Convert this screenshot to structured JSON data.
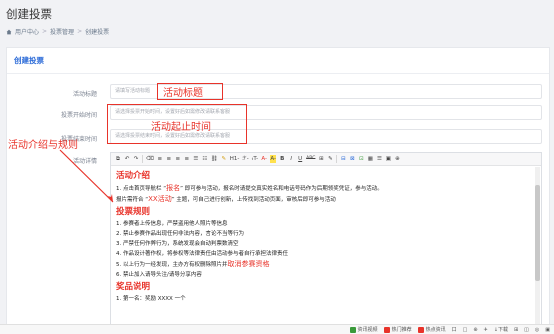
{
  "page": {
    "title": "创建投票"
  },
  "breadcrumb": {
    "items": [
      "用户中心",
      "投票管理",
      "创建投票"
    ],
    "sep": ">"
  },
  "card": {
    "header": "创建投票"
  },
  "form": {
    "activity_title_label": "活动标题",
    "activity_title_placeholder": "请填写活动标题",
    "start_time_label": "投票开始时间",
    "start_time_placeholder": "请选择投票开始时间，设置好后如需修改请联系客服",
    "end_time_label": "投票结束时间",
    "end_time_placeholder": "请选择投票结束时间，设置好后如需修改请联系客服",
    "details_label": "活动详情"
  },
  "annotations": {
    "title_note": "活动标题",
    "time_note": "活动起止时间",
    "intro_note": "活动介绍与规则",
    "accent_color": "#e8332a"
  },
  "toolbar": {
    "buttons": [
      "源码",
      "撤销",
      "重做",
      "清除",
      "左对齐",
      "居中",
      "右对齐",
      "两端",
      "有序",
      "无序",
      "链接",
      "格式刷",
      "H1-",
      "ℱ-",
      "ₜT-",
      "A-",
      "A-",
      "B",
      "I",
      "U",
      "ABC",
      "⊞",
      "✎",
      "⊟",
      "⊠",
      "⊡",
      "▦",
      "☰",
      "▣",
      "⊕"
    ]
  },
  "editor": {
    "sec1": "活动介绍",
    "line1_a": "1. 点击首页导航栏 “",
    "line1_hl": "报名",
    "line1_b": "” 即可参与活动，报名时请提交真实姓名和电话号码作为后期领奖凭证，参与活动。",
    "line2_a": "报片需符合 “",
    "line2_hl": "XX活动",
    "line2_b": "” 主题，可自己进行创新，上传找到活动页面，审核后即可参与活动",
    "sec2": "投票规则",
    "rules": [
      "1. 参赛者上传信息，严禁盗用他人照片等信息",
      "2. 禁止参赛作品出现任何非法内容，言论不当等行为",
      "3. 严禁任何作弊行为，系统发现会自动判票数清空",
      "4. 作品设计著作权，将参权等法律责任由活动参与者自行承担法律责任"
    ],
    "rule5_a": "5. 以上行为一经发现，主办方有权删除照片并",
    "rule5_hl": "取消参赛资格",
    "rule6": "6. 禁止加入请导头注/请导分享内容",
    "sec3": "奖品说明",
    "prize1": "1. 第一名：奖励 XXXX 一个"
  },
  "taskbar": {
    "items": [
      "资讯视频",
      "热门推荐",
      "热点资讯",
      "口",
      "□",
      "⊕",
      "✈",
      "↓下载",
      "⊞",
      "◫",
      "◎",
      "▣"
    ]
  }
}
